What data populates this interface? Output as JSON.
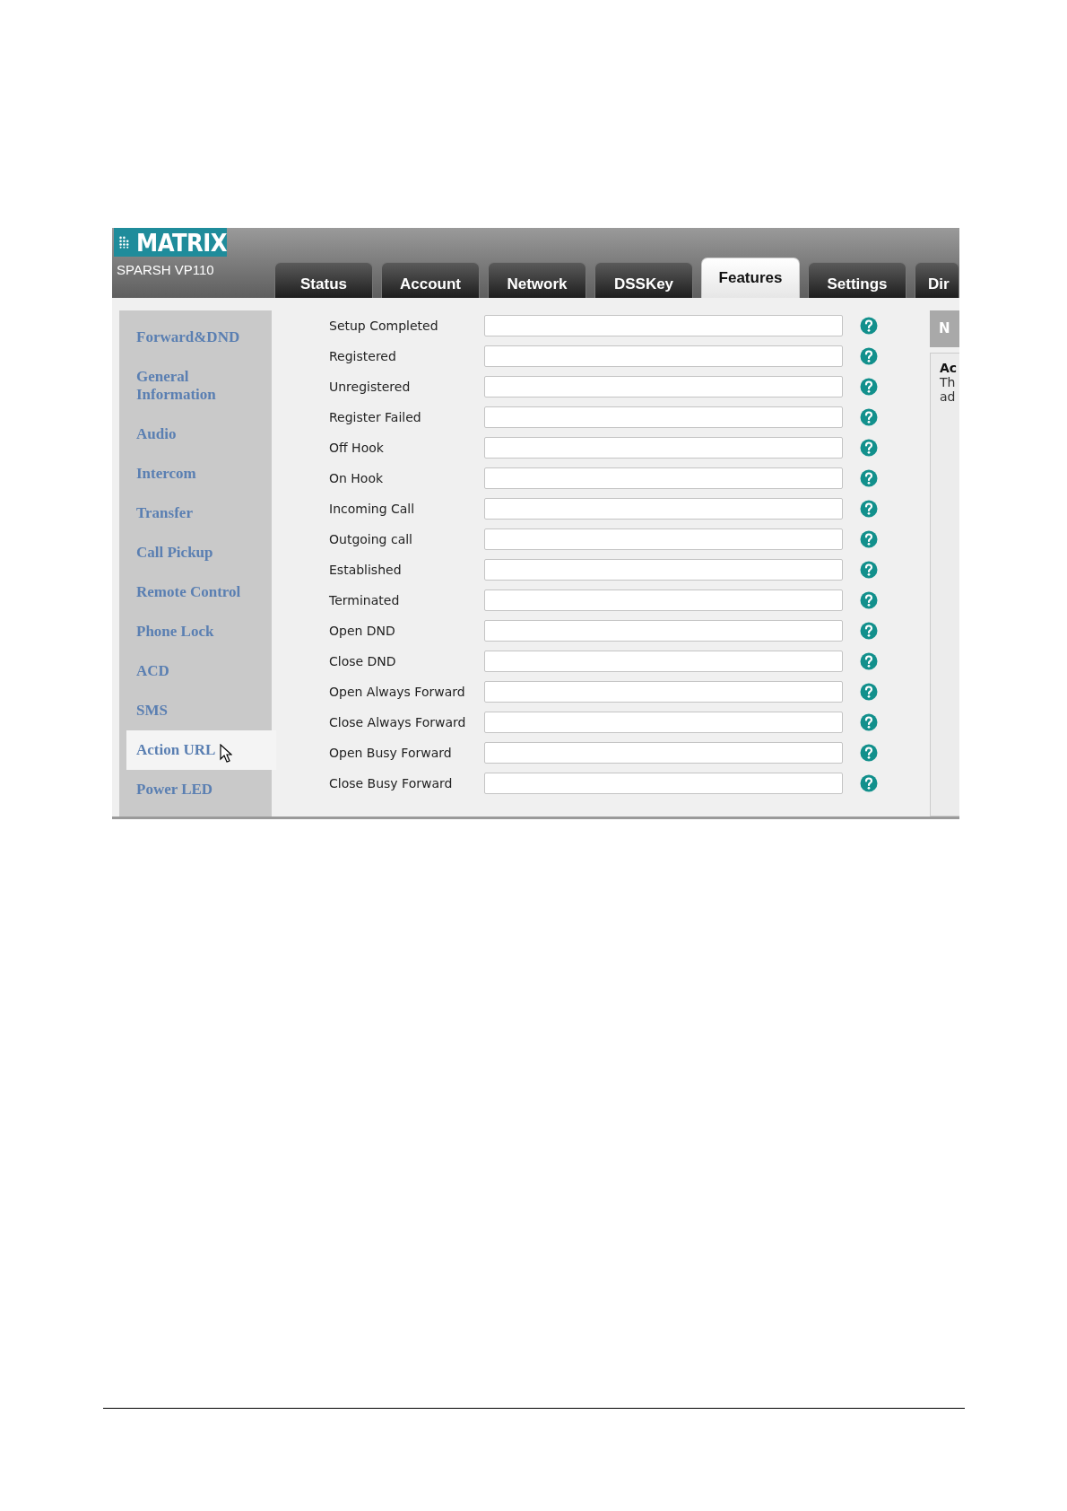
{
  "header": {
    "logo": "MATRIX",
    "model": "SPARSH VP110"
  },
  "tabs": [
    {
      "label": "Status",
      "selected": false
    },
    {
      "label": "Account",
      "selected": false
    },
    {
      "label": "Network",
      "selected": false
    },
    {
      "label": "DSSKey",
      "selected": false
    },
    {
      "label": "Features",
      "selected": true
    },
    {
      "label": "Settings",
      "selected": false
    },
    {
      "label": "Dir",
      "selected": false
    }
  ],
  "sidebar": {
    "items": [
      {
        "label": "Forward&DND",
        "selected": false
      },
      {
        "label": "General Information",
        "selected": false
      },
      {
        "label": "Audio",
        "selected": false
      },
      {
        "label": "Intercom",
        "selected": false
      },
      {
        "label": "Transfer",
        "selected": false
      },
      {
        "label": "Call Pickup",
        "selected": false
      },
      {
        "label": "Remote Control",
        "selected": false
      },
      {
        "label": "Phone Lock",
        "selected": false
      },
      {
        "label": "ACD",
        "selected": false
      },
      {
        "label": "SMS",
        "selected": false
      },
      {
        "label": "Action URL",
        "selected": true
      },
      {
        "label": "Power LED",
        "selected": false
      }
    ]
  },
  "form": {
    "fields": [
      {
        "label": "Setup Completed"
      },
      {
        "label": "Registered"
      },
      {
        "label": "Unregistered"
      },
      {
        "label": "Register Failed"
      },
      {
        "label": "Off Hook"
      },
      {
        "label": "On Hook"
      },
      {
        "label": "Incoming Call"
      },
      {
        "label": "Outgoing call"
      },
      {
        "label": "Established"
      },
      {
        "label": "Terminated"
      },
      {
        "label": "Open DND"
      },
      {
        "label": "Close DND"
      },
      {
        "label": "Open Always Forward"
      },
      {
        "label": "Close Always Forward"
      },
      {
        "label": "Open Busy Forward"
      },
      {
        "label": "Close Busy Forward"
      }
    ]
  },
  "note_panel": {
    "title": "N",
    "heading": "Ac",
    "lines": [
      "Th",
      "ad"
    ]
  }
}
